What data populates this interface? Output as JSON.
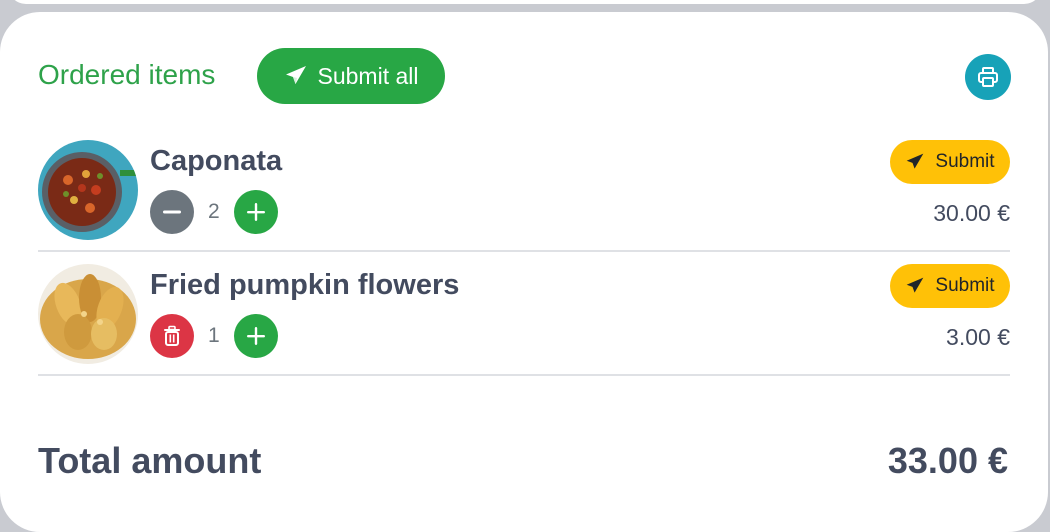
{
  "header": {
    "title": "Ordered items",
    "submit_all_label": "Submit all"
  },
  "items": [
    {
      "name": "Caponata",
      "quantity": "2",
      "submit_label": "Submit",
      "price": "30.00 €",
      "image": "caponata-dish"
    },
    {
      "name": "Fried pumpkin flowers",
      "quantity": "1",
      "submit_label": "Submit",
      "price": "3.00 €",
      "image": "fried-pumpkin-flowers"
    }
  ],
  "total": {
    "label": "Total amount",
    "value": "33.00 €"
  },
  "colors": {
    "accent_green": "#28a745",
    "title_green": "#2ea24a",
    "submit_yellow": "#ffc107",
    "print_teal": "#17a2b8",
    "delete_red": "#dc3545",
    "minus_gray": "#6c757d",
    "text_dark": "#434b5f"
  },
  "icons": {
    "submit": "paper-plane-icon",
    "print": "printer-icon",
    "minus": "minus-icon",
    "plus": "plus-icon",
    "delete": "trash-icon"
  }
}
